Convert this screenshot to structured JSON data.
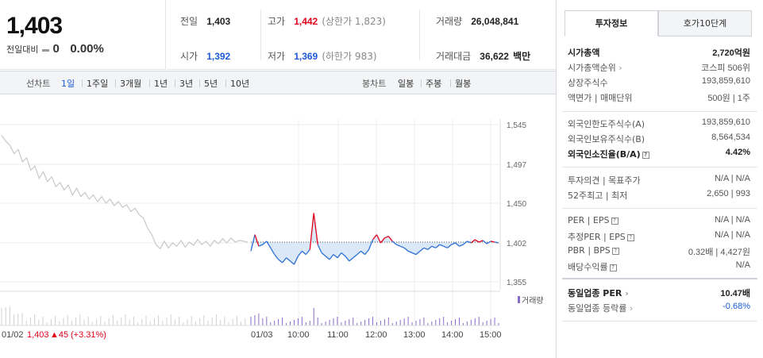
{
  "quote": {
    "price": "1,403",
    "change_label": "전일대비",
    "change_value": "0",
    "change_pct": "0.00%"
  },
  "stats": {
    "prev_label": "전일",
    "prev_value": "1,403",
    "high_label": "고가",
    "high_value": "1,442",
    "upper_limit": "(상한가 1,823)",
    "volume_label": "거래량",
    "volume_value": "26,048,841",
    "open_label": "시가",
    "open_value": "1,392",
    "low_label": "저가",
    "low_value": "1,369",
    "lower_limit": "(하한가 983)",
    "amount_label": "거래대금",
    "amount_value": "36,622",
    "amount_unit": "백만"
  },
  "tabs": {
    "line_label": "선차트",
    "line_periods": [
      "1일",
      "1주일",
      "3개월",
      "1년",
      "3년",
      "5년",
      "10년"
    ],
    "selected_period": "1일",
    "candle_label": "봉차트",
    "candle_periods": [
      "일봉",
      "주봉",
      "월봉"
    ]
  },
  "chart_data": {
    "type": "line",
    "y_ticks": [
      "1,545",
      "1,497",
      "1,450",
      "1,402",
      "1,355"
    ],
    "y_tick_values": [
      1545,
      1497,
      1450,
      1402,
      1355
    ],
    "ylim": [
      1340,
      1560
    ],
    "base_price": 1403,
    "x_ticks": [
      "01/02",
      "01/03",
      "10:00",
      "11:00",
      "12:00",
      "13:00",
      "14:00",
      "15:00"
    ],
    "volume_legend": "거래량",
    "prev_day_footer": {
      "date": "01/02",
      "price": "1,403",
      "change": "▲45",
      "pct": "(+3.31%)"
    },
    "up_color": "#e2001a",
    "down_color": "#2b6fd6",
    "fill_color": "#dbe8f7",
    "prev_color": "#c8c8c8",
    "prev_day_series": [
      1532,
      1525,
      1520,
      1510,
      1515,
      1500,
      1505,
      1490,
      1495,
      1480,
      1488,
      1476,
      1482,
      1470,
      1475,
      1466,
      1472,
      1460,
      1468,
      1458,
      1463,
      1455,
      1460,
      1452,
      1458,
      1450,
      1455,
      1447,
      1452,
      1445,
      1448,
      1440,
      1444,
      1436,
      1432,
      1420,
      1412,
      1400,
      1395,
      1404,
      1396,
      1402,
      1398,
      1405,
      1397,
      1403,
      1399,
      1406,
      1400,
      1404,
      1398,
      1405,
      1401,
      1407,
      1402,
      1408,
      1403,
      1405,
      1404,
      1403
    ],
    "today_series": [
      1392,
      1412,
      1398,
      1400,
      1404,
      1396,
      1388,
      1382,
      1378,
      1384,
      1380,
      1376,
      1386,
      1392,
      1388,
      1394,
      1438,
      1400,
      1390,
      1386,
      1382,
      1388,
      1384,
      1390,
      1386,
      1380,
      1384,
      1388,
      1392,
      1388,
      1394,
      1406,
      1412,
      1402,
      1408,
      1410,
      1404,
      1400,
      1398,
      1396,
      1392,
      1390,
      1388,
      1392,
      1396,
      1394,
      1398,
      1396,
      1400,
      1398,
      1396,
      1400,
      1402,
      1398,
      1400,
      1404,
      1402,
      1406,
      1403,
      1405,
      1401,
      1404,
      1403,
      1402
    ]
  },
  "invest": {
    "tab_info": "투자정보",
    "tab_quote": "호가10단계",
    "rows_a": [
      {
        "label": "시가총액",
        "value": "2,720억원",
        "bold": true
      },
      {
        "label": "시가총액순위",
        "value": "코스피 506위",
        "arrow": true
      },
      {
        "label": "상장주식수",
        "value": "193,859,610"
      },
      {
        "label": "액면가 | 매매단위",
        "value": "500원 | 1주"
      }
    ],
    "rows_b": [
      {
        "label": "외국인한도주식수(A)",
        "value": "193,859,610"
      },
      {
        "label": "외국인보유주식수(B)",
        "value": "8,564,534"
      },
      {
        "label": "외국인소진율(B/A)",
        "value": "4.42%",
        "bold": true,
        "help": true
      }
    ],
    "rows_c": [
      {
        "label": "투자의견 | 목표주가",
        "value": "N/A | N/A"
      },
      {
        "label": "52주최고 | 최저",
        "value": "2,650 | 993"
      }
    ],
    "rows_d": [
      {
        "label": "PER | EPS",
        "value": "N/A | N/A",
        "help": true
      },
      {
        "label": "추정PER | EPS",
        "value": "N/A | N/A",
        "help": true
      },
      {
        "label": "PBR | BPS",
        "value": "0.32배 | 4,427원",
        "help": true
      },
      {
        "label": "배당수익률",
        "value": "N/A",
        "help": true
      }
    ],
    "rows_e": [
      {
        "label": "동일업종 PER",
        "value": "10.47배",
        "bold": true,
        "arrow": true
      },
      {
        "label": "동일업종 등락률",
        "value": "-0.68%",
        "arrow": true,
        "value_color": "#1c5bd9"
      }
    ]
  }
}
